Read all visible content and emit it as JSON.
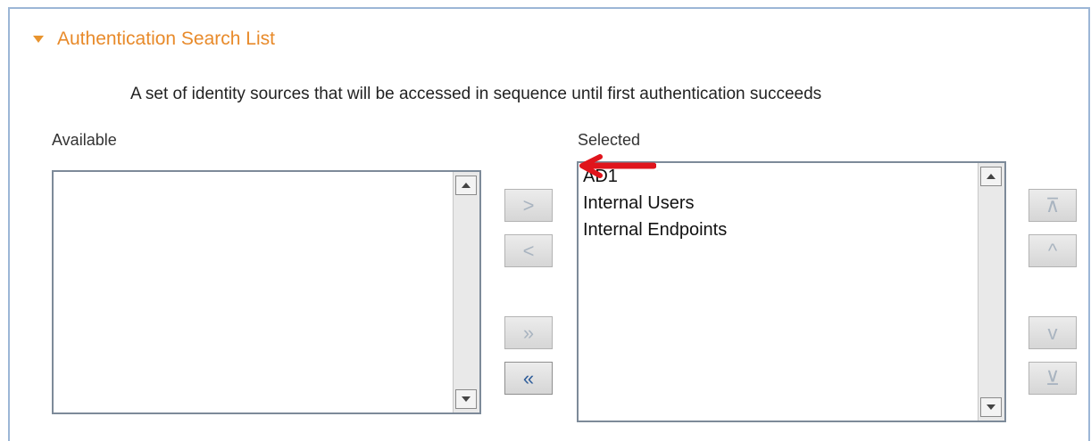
{
  "section": {
    "title": "Authentication Search List"
  },
  "description": "A set of identity sources that will be accessed in sequence until first authentication succeeds",
  "available": {
    "label": "Available",
    "items": []
  },
  "selected": {
    "label": "Selected",
    "items": [
      "AD1",
      "Internal Users",
      "Internal Endpoints"
    ]
  },
  "move_buttons": {
    "move_right": ">",
    "move_left": "<",
    "move_all_right": "»",
    "move_all_left": "«"
  },
  "order_buttons": {
    "top": "⊼",
    "up": "^",
    "down": "v",
    "bottom": "⊻"
  },
  "colors": {
    "accent": "#e88a2a",
    "panel_border": "#9cb6d6",
    "annotation_arrow": "#e0141c"
  }
}
